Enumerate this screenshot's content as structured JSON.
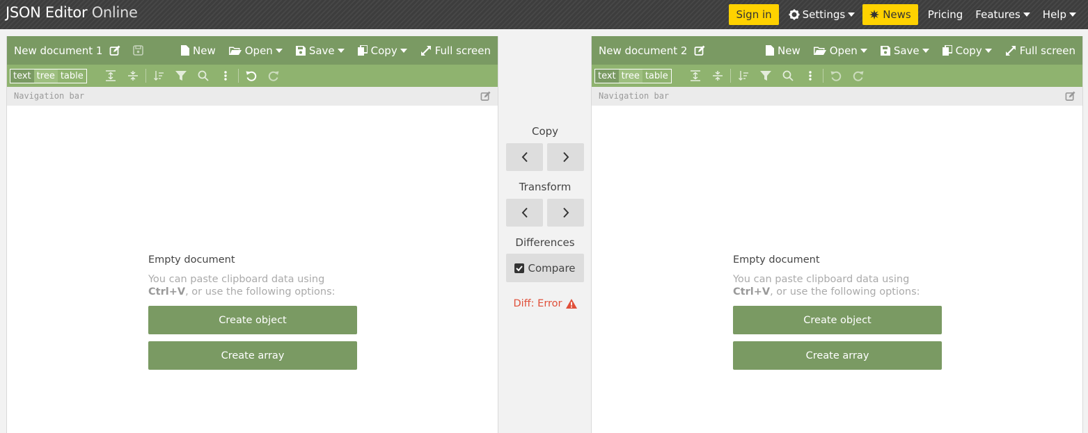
{
  "header": {
    "logo_main": "JSON Editor",
    "logo_light": "Online",
    "signin_label": "Sign in",
    "settings_label": "Settings",
    "news_label": "News",
    "pricing_label": "Pricing",
    "features_label": "Features",
    "help_label": "Help"
  },
  "left_panel": {
    "title": "New document 1",
    "menu": {
      "new": "New",
      "open": "Open",
      "save": "Save",
      "copy": "Copy",
      "fullscreen": "Full screen"
    },
    "modes": [
      "text",
      "tree",
      "table"
    ],
    "nav_placeholder": "Navigation bar",
    "empty": {
      "title": "Empty document",
      "hint_pre": "You can paste clipboard data using",
      "hint_key": "Ctrl+V",
      "hint_post": ", or use the following options:",
      "create_object": "Create object",
      "create_array": "Create array"
    }
  },
  "right_panel": {
    "title": "New document 2",
    "menu": {
      "new": "New",
      "open": "Open",
      "save": "Save",
      "copy": "Copy",
      "fullscreen": "Full screen"
    },
    "modes": [
      "text",
      "tree",
      "table"
    ],
    "nav_placeholder": "Navigation bar",
    "empty": {
      "title": "Empty document",
      "hint_pre": "You can paste clipboard data using",
      "hint_key": "Ctrl+V",
      "hint_post": ", or use the following options:",
      "create_object": "Create object",
      "create_array": "Create array"
    }
  },
  "middle": {
    "copy_label": "Copy",
    "transform_label": "Transform",
    "differences_label": "Differences",
    "compare_label": "Compare",
    "diff_status": "Diff: Error"
  },
  "colors": {
    "header_bg": "#3d3d3d",
    "accent_yellow": "#ffd200",
    "menu_green": "#7a9a63",
    "toolbar_green": "#8fb36f",
    "error_red": "#e04f39"
  }
}
